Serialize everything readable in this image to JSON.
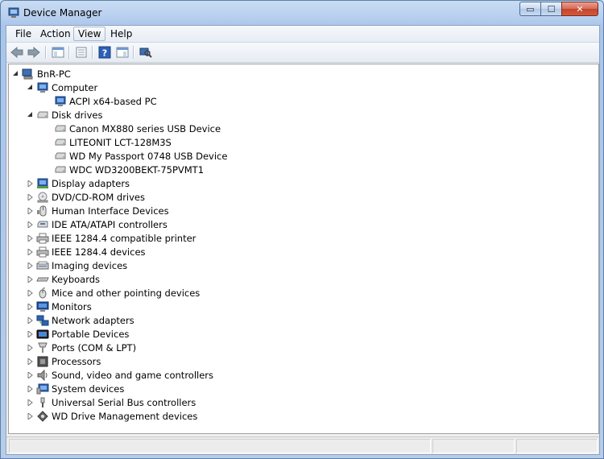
{
  "window": {
    "title": "Device Manager",
    "buttons": {
      "minimize": "▭",
      "maximize": "☐",
      "close": "✕"
    }
  },
  "menu": [
    "File",
    "Action",
    "View",
    "Help"
  ],
  "menu_active": "View",
  "tree": {
    "root": "BnR-PC",
    "computer": {
      "label": "Computer",
      "children": [
        "ACPI x64-based PC"
      ]
    },
    "disk_drives": {
      "label": "Disk drives",
      "children": [
        "Canon MX880 series USB Device",
        "LITEONIT LCT-128M3S",
        "WD My Passport 0748 USB Device",
        "WDC WD3200BEKT-75PVMT1"
      ]
    },
    "categories": [
      "Display adapters",
      "DVD/CD-ROM drives",
      "Human Interface Devices",
      "IDE ATA/ATAPI controllers",
      "IEEE 1284.4 compatible printer",
      "IEEE 1284.4 devices",
      "Imaging devices",
      "Keyboards",
      "Mice and other pointing devices",
      "Monitors",
      "Network adapters",
      "Portable Devices",
      "Ports (COM & LPT)",
      "Processors",
      "Sound, video and game controllers",
      "System devices",
      "Universal Serial Bus controllers",
      "WD Drive Management devices"
    ]
  }
}
